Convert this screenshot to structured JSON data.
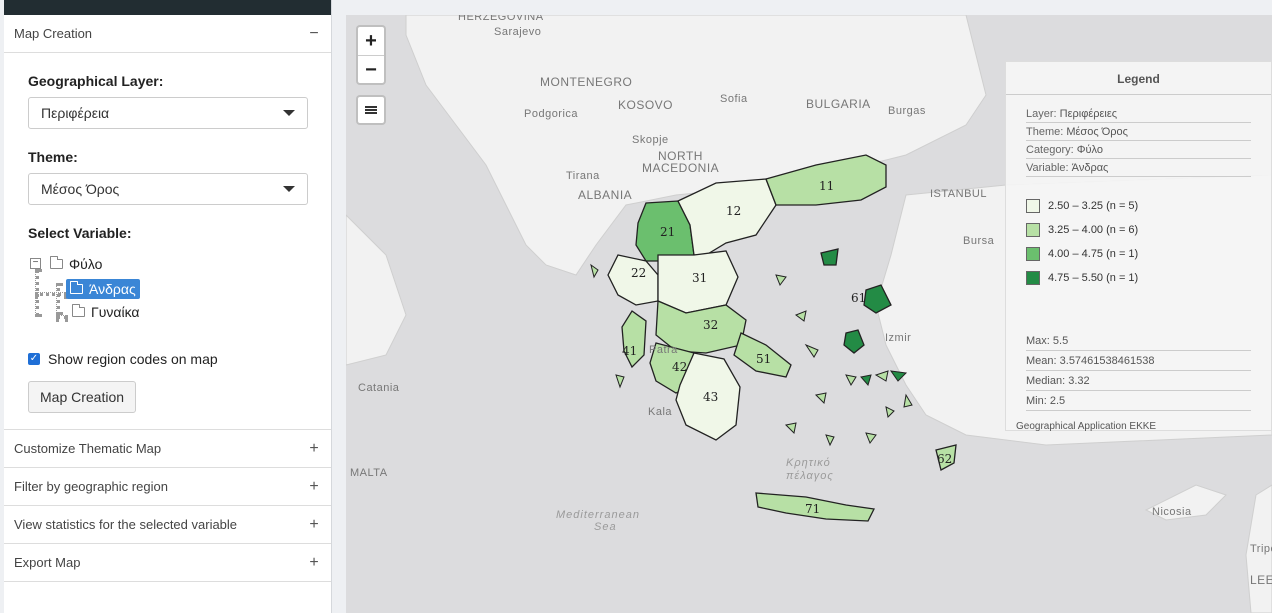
{
  "sidebar": {
    "panels": {
      "map_creation": {
        "title": "Map Creation",
        "toggle": "−"
      },
      "customize": {
        "title": "Customize Thematic Map",
        "toggle": "+"
      },
      "filter": {
        "title": "Filter by geographic region",
        "toggle": "+"
      },
      "stats": {
        "title": "View statistics for the selected variable",
        "toggle": "+"
      },
      "export": {
        "title": "Export Map",
        "toggle": "+"
      }
    },
    "geo_layer": {
      "label": "Geographical Layer:",
      "value": "Περιφέρεια"
    },
    "theme": {
      "label": "Theme:",
      "value": "Μέσος Όρος"
    },
    "variable": {
      "label": "Select Variable:",
      "tree": {
        "root": "Φύλο",
        "children": [
          "Άνδρας",
          "Γυναίκα"
        ],
        "selected": "Άνδρας"
      }
    },
    "show_codes": {
      "label": "Show region codes on map",
      "checked": true
    },
    "create_button": "Map Creation"
  },
  "map": {
    "zoom_in": "+",
    "zoom_out": "−",
    "places": {
      "herzegovina": "HERZEGOVINA",
      "sarajevo": "Sarajevo",
      "montenegro": "MONTENEGRO",
      "kosovo": "KOSOVO",
      "sofia": "Sofia",
      "bulgaria": "BULGARIA",
      "burgas": "Burgas",
      "podgorica": "Podgorica",
      "skopje": "Skopje",
      "north_macedonia_1": "NORTH",
      "north_macedonia_2": "MACEDONIA",
      "tirana": "Tirana",
      "albania": "ALBANIA",
      "istanbul": "ISTANBUL",
      "bursa": "Bursa",
      "izmir": "Izmir",
      "patra": "Patra",
      "kalamata": "Kala",
      "catania": "Catania",
      "malta": "MALTA",
      "nicosia": "Nicosia",
      "tripoli": "Tripo",
      "lebanon": "LEE",
      "kritiko_1": "Κρητικό",
      "kritiko_2": "πέλαγος",
      "med_1": "Mediterranean",
      "med_2": "Sea"
    },
    "region_codes": [
      "11",
      "12",
      "21",
      "22",
      "31",
      "32",
      "41",
      "42",
      "43",
      "51",
      "61",
      "62",
      "71"
    ],
    "colors": {
      "c1": "#f0f7e8",
      "c2": "#b7e0a5",
      "c3": "#6bbf6e",
      "c4": "#238b45"
    }
  },
  "legend": {
    "title": "Legend",
    "layer_key": "Layer:",
    "layer": "Περιφέρειες",
    "theme_key": "Theme:",
    "theme": "Μέσος Όρος",
    "category_key": "Category:",
    "category": "Φύλο",
    "variable_key": "Variable:",
    "variable": "Άνδρας",
    "bins": [
      {
        "label": "2.50 – 3.25 (n = 5)",
        "color": "#f0f7e8"
      },
      {
        "label": "3.25 – 4.00 (n = 6)",
        "color": "#b7e0a5"
      },
      {
        "label": "4.00 – 4.75 (n = 1)",
        "color": "#6bbf6e"
      },
      {
        "label": "4.75 – 5.50 (n = 1)",
        "color": "#238b45"
      }
    ],
    "max_key": "Max:",
    "max": "5.5",
    "mean_key": "Mean:",
    "mean": "3.57461538461538",
    "median_key": "Median:",
    "median": "3.32",
    "min_key": "Min:",
    "min": "2.5",
    "footer": "Geographical Application EKKE"
  }
}
